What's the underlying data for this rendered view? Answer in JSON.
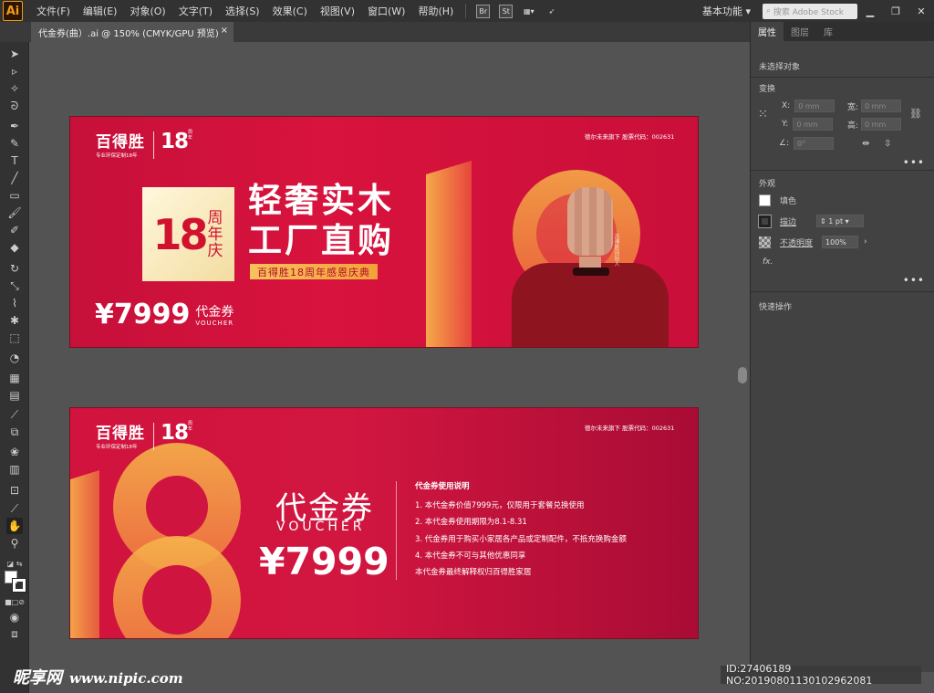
{
  "menubar": {
    "app_icon": "Ai",
    "items": [
      "文件(F)",
      "编辑(E)",
      "对象(O)",
      "文字(T)",
      "选择(S)",
      "效果(C)",
      "视图(V)",
      "窗口(W)",
      "帮助(H)"
    ],
    "bridge": "Br",
    "stock": "St",
    "workspace": "基本功能",
    "search_placeholder": "搜索 Adobe Stock"
  },
  "document_tab": {
    "title": "代金券(曲）.ai @ 150% (CMYK/GPU 预览)",
    "close": "×"
  },
  "properties": {
    "tabs": [
      "属性",
      "图层",
      "库"
    ],
    "no_selection": "未选择对象",
    "transform_title": "变换",
    "x_label": "X:",
    "y_label": "Y:",
    "w_label": "宽:",
    "h_label": "高:",
    "x_value": "0 mm",
    "y_value": "0 mm",
    "w_value": "0 mm",
    "h_value": "0 mm",
    "angle_label": "∠:",
    "angle_value": "0°",
    "appearance_title": "外观",
    "fill_label": "填色",
    "stroke_label": "描边",
    "stroke_value": "1 pt",
    "opacity_label": "不透明度",
    "opacity_value": "100%",
    "fx": "fx.",
    "quick_actions": "快速操作",
    "more": "•••"
  },
  "watermark": {
    "brand": "昵享网",
    "url": "www.nipic.com"
  },
  "status": {
    "text": "ID:27406189 NO:20190801130102962081"
  },
  "artboard1": {
    "logo": "百得胜",
    "logo_sub": "专业环保定制18年",
    "logo_18": "18",
    "logo_18_side": "周年",
    "company": "德尔未来旗下 股票代码：002631",
    "badge_num": "18",
    "badge_side": "周年庆",
    "headline1": "轻奢实木",
    "headline2": "工厂直购",
    "ribbon": "百得胜18周年感恩庆典",
    "price": "¥7999",
    "price_label": "代金券",
    "price_en": "VOUCHER",
    "big_number": "18",
    "signature": "百得胜创始人"
  },
  "artboard2": {
    "logo": "百得胜",
    "logo_sub": "专业环保定制18年",
    "logo_18": "18",
    "logo_18_side": "周年",
    "company": "德尔未来旗下 股票代码：002631",
    "title": "代金券",
    "title_en": "VOUCHER",
    "price": "¥7999",
    "big_number": "18",
    "terms_title": "代金券使用说明",
    "terms": [
      "1. 本代金券价值7999元，仅限用于套餐兑换使用",
      "2. 本代金券使用期限为8.1-8.31",
      "3. 代金券用于购买小家居各产品或定制配件，不抵充换购金额",
      "4. 本代金券不可与其他优惠同享",
      "本代金券最终解释权归百得胜家居"
    ]
  },
  "colors": {
    "accent": "#d8133d",
    "gold": "#f3a03b",
    "ui_dark": "#323232",
    "canvas": "#535353"
  }
}
